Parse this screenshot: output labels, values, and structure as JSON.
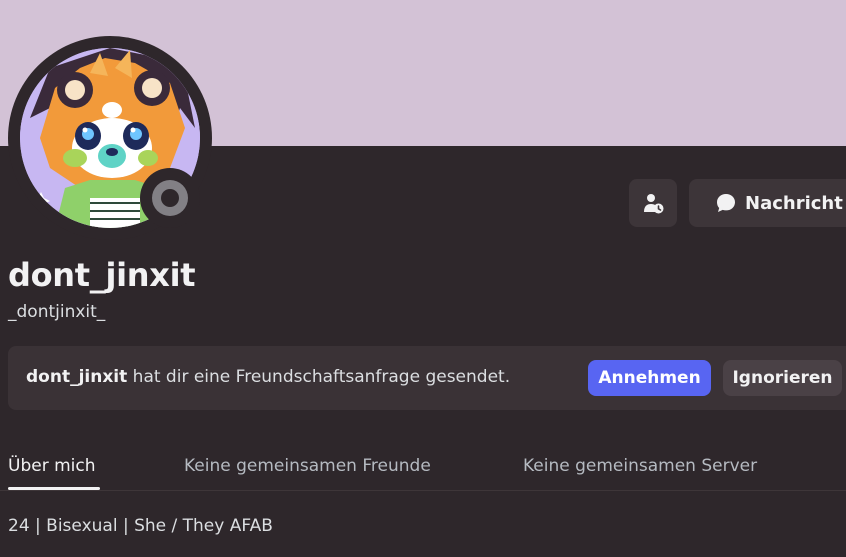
{
  "profile": {
    "display_name": "dont_jinxit",
    "username": "_dontjinxit_",
    "status": "offline",
    "banner_color": "#d3c2d6"
  },
  "actions": {
    "friend_icon": "user-pending-icon",
    "message_icon": "chat-bubble-icon",
    "message_label": "Nachricht"
  },
  "friend_request": {
    "sender": "dont_jinxit",
    "text": " hat dir eine Freundschaftsanfrage gesendet.",
    "accept_label": "Annehmen",
    "ignore_label": "Ignorieren",
    "accept_color": "#5865f2"
  },
  "tabs": [
    {
      "label": "Über mich",
      "active": true
    },
    {
      "label": "Keine gemeinsamen Freunde",
      "active": false
    },
    {
      "label": "Keine gemeinsamen Server",
      "active": false
    }
  ],
  "about": {
    "bio": "24 | Bisexual | She / They AFAB"
  }
}
